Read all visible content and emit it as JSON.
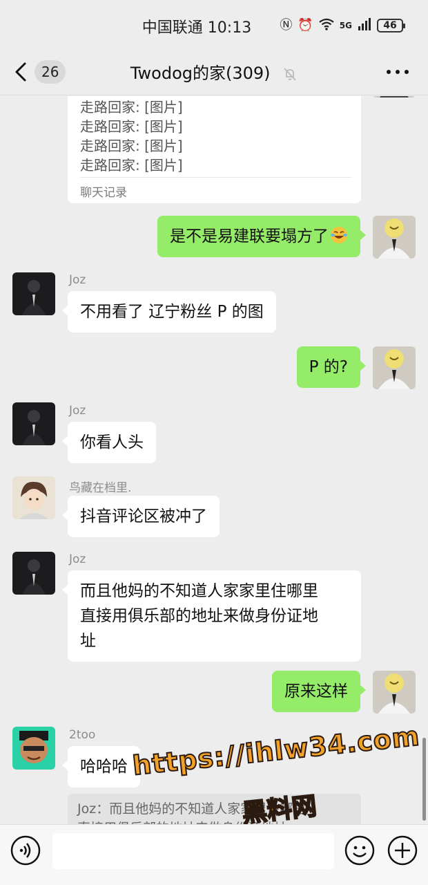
{
  "status_bar": {
    "carrier_time": "中国联通 10:13",
    "network": "5G",
    "battery": "46"
  },
  "nav": {
    "unread_count": "26",
    "title": "Twodog的家(309)"
  },
  "forwarded_card": {
    "lines": [
      "走路回家: [图片]",
      "走路回家: [图片]",
      "走路回家: [图片]",
      "走路回家: [图片]"
    ],
    "footer": "聊天记录"
  },
  "messages": [
    {
      "side": "out",
      "text": "是不是易建联要塌方了"
    },
    {
      "side": "in",
      "sender": "Joz",
      "text": "不用看了 辽宁粉丝 P 的图"
    },
    {
      "side": "out",
      "text": "P 的?"
    },
    {
      "side": "in",
      "sender": "Joz",
      "text": "你看人头"
    },
    {
      "side": "in",
      "sender": "鸟藏在档里.",
      "text": "抖音评论区被冲了"
    },
    {
      "side": "in",
      "sender": "Joz",
      "text_line1": "而且他妈的不知道人家家里住哪里",
      "text_line2": "直接用俱乐部的地址来做身份证地",
      "text_line3": "址"
    },
    {
      "side": "out",
      "text": "原来这样"
    },
    {
      "side": "in",
      "sender": "2too",
      "text": "哈哈哈"
    }
  ],
  "quote": {
    "line1": "Joz：而且他妈的不知道人家家里住哪里",
    "line2": "直接用俱乐部的地址来做身份证地址"
  },
  "watermark": {
    "url": "https://ihlw34.com",
    "name": "黑料网"
  },
  "colors": {
    "outgoing_bubble": "#95ec69",
    "incoming_bubble": "#ffffff",
    "background": "#ededed"
  }
}
